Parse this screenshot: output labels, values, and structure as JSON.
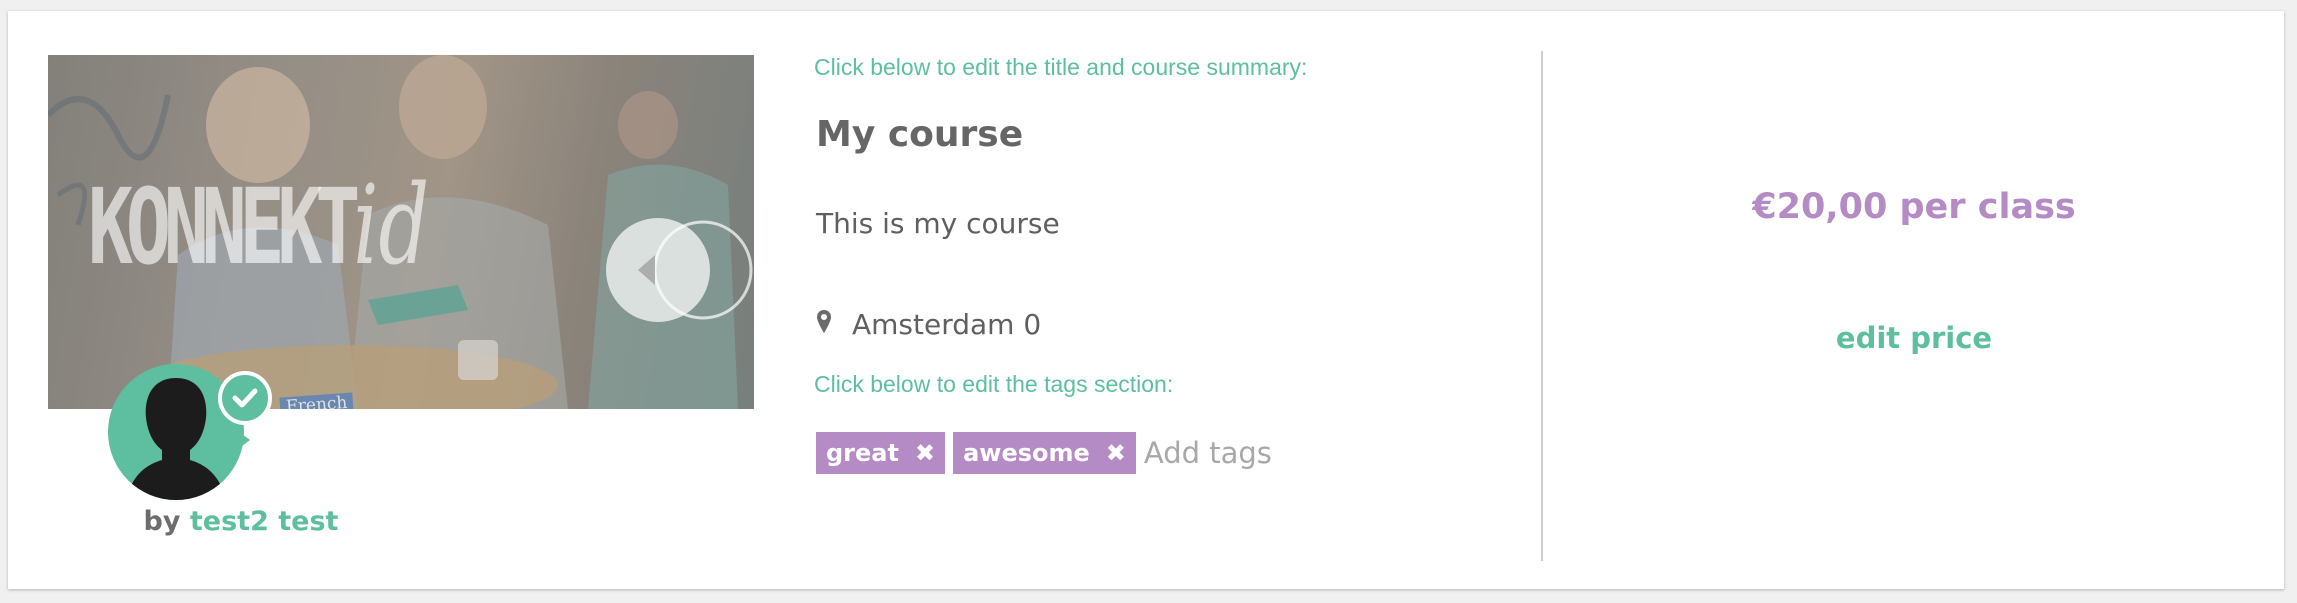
{
  "course": {
    "title_hint": "Click below to edit the title and course summary:",
    "title": "My course",
    "summary": "This is my course",
    "location": "Amsterdam 0",
    "tags_hint": "Click below to edit the tags section:",
    "tags": [
      {
        "label": "great",
        "remove_icon": "✖"
      },
      {
        "label": "awesome",
        "remove_icon": "✖"
      }
    ],
    "add_tags_placeholder": "Add tags"
  },
  "image": {
    "brand": "KONNEKT",
    "brand_script": "id",
    "book_label": "French"
  },
  "teacher": {
    "by_label": "by",
    "name": "test2 test"
  },
  "pricing": {
    "price": "€20,00 per class",
    "edit_label": "edit price"
  },
  "colors": {
    "accent_green": "#5dbf9f",
    "accent_purple": "#b48bc4",
    "text_gray": "#5f5f5f"
  },
  "icons": [
    "map-pin-icon",
    "check-icon",
    "remove-tag-icon",
    "avatar-silhouette-icon"
  ]
}
